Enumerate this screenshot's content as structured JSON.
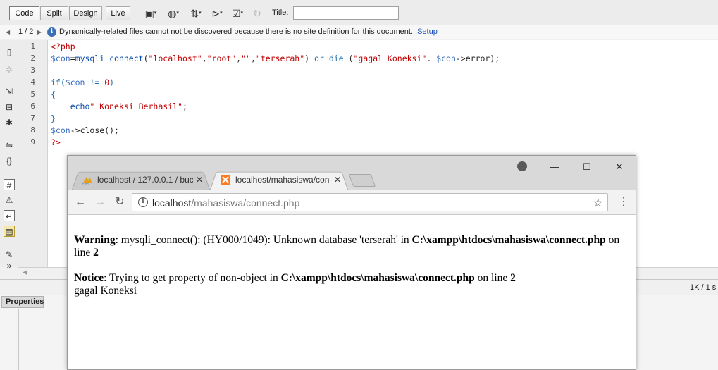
{
  "toolbar": {
    "code_label": "Code",
    "split_label": "Split",
    "design_label": "Design",
    "live_label": "Live",
    "title_label": "Title:",
    "title_value": "",
    "icons": [
      "multiscreen-icon",
      "preview-in-browser-icon",
      "file-management-icon",
      "visual-aids-icon",
      "validate-markup-icon",
      "refresh-icon"
    ]
  },
  "infobar": {
    "counter": "1 / 2",
    "message": "Dynamically-related files cannot not be discovered because there is no site definition for this document.",
    "setup_link": "Setup"
  },
  "code": {
    "line_numbers": [
      "1",
      "2",
      "3",
      "4",
      "5",
      "6",
      "7",
      "8",
      "9"
    ],
    "lines": {
      "l1_tag": "<?php",
      "l2_var1": "$con",
      "l2_eq": "=",
      "l2_fn": "mysqli_connect",
      "l2_paren": "(",
      "l2_s1": "\"localhost\"",
      "l2_c1": ",",
      "l2_s2": "\"root\"",
      "l2_c2": ",",
      "l2_s3": "\"\"",
      "l2_c3": ",",
      "l2_s4": "\"terserah\"",
      "l2_close": ") ",
      "l2_or": "or",
      "l2_sp": " ",
      "l2_die": "die",
      "l2_open": " (",
      "l2_s5": "\"gagal Koneksi\"",
      "l2_dot": ". ",
      "l2_var2": "$con",
      "l2_arrow": "->",
      "l2_tail": "error);",
      "l4_if": "if(",
      "l4_var": "$con",
      "l4_op": " != ",
      "l4_num": "0",
      "l4_close": ")",
      "l5_brace": "{",
      "l6_echo": "    echo",
      "l6_str": "\" Koneksi Berhasil\"",
      "l6_semi": ";",
      "l7_brace": "}",
      "l8_var": "$con",
      "l8_arrow": "->",
      "l8_tail": "close();",
      "l9_tag": "?>"
    }
  },
  "status": {
    "size": "1K / 1 s"
  },
  "properties": {
    "tab_label": "Properties"
  },
  "browser": {
    "tabs": [
      {
        "title": "localhost / 127.0.0.1 / buc",
        "favicon": "phpmyadmin-icon"
      },
      {
        "title": "localhost/mahasiswa/con",
        "favicon": "xampp-icon"
      }
    ],
    "url_host": "localhost",
    "url_path": "/mahasiswa/connect.php",
    "page": {
      "warning_label": "Warning",
      "warning_text": ": mysqli_connect(): (HY000/1049): Unknown database 'terserah' in ",
      "warning_path": "C:\\xampp\\htdocs\\mahasiswa\\connect.php",
      "warning_on_line": " on line ",
      "warning_line": "2",
      "notice_label": "Notice",
      "notice_text": ": Trying to get property of non-object in ",
      "notice_path": "C:\\xampp\\htdocs\\mahasiswa\\connect.php",
      "notice_on_line": " on line ",
      "notice_line": "2",
      "output": "gagal Koneksi"
    }
  }
}
